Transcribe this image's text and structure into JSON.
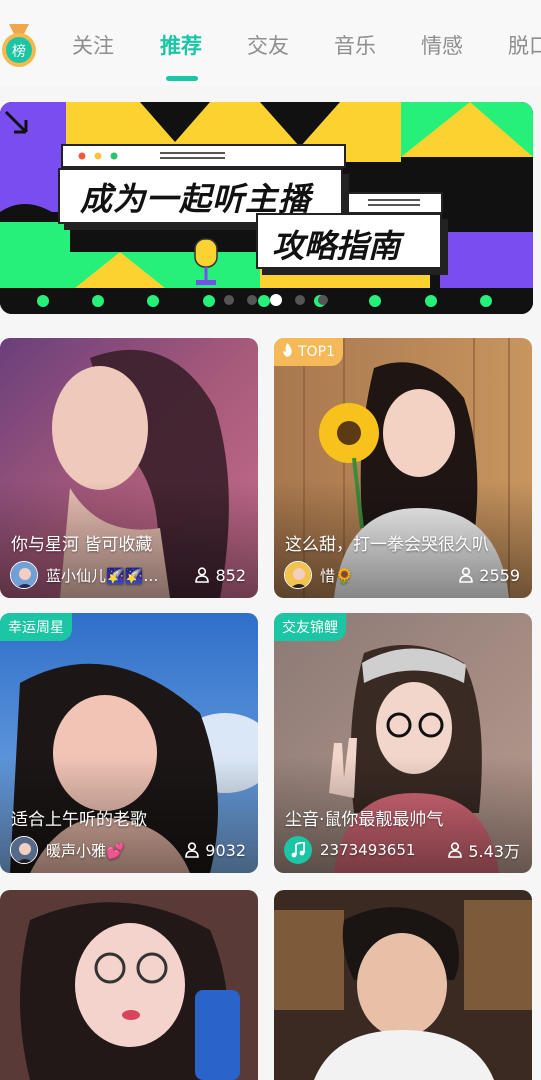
{
  "header": {
    "rank_badge_label": "榜",
    "tabs": [
      {
        "label": "关注",
        "active": false
      },
      {
        "label": "推荐",
        "active": true
      },
      {
        "label": "交友",
        "active": false
      },
      {
        "label": "音乐",
        "active": false
      },
      {
        "label": "情感",
        "active": false
      },
      {
        "label": "脱口",
        "active": false
      }
    ]
  },
  "banner": {
    "line1": "成为一起听主播",
    "line2": "攻略指南",
    "slide_count": 5,
    "active_slide": 3
  },
  "cards": [
    {
      "title": "你与星河 皆可收藏",
      "user": "蓝小仙儿🌠🌠…",
      "listeners": "852",
      "tag": "",
      "avatar_type": "photo"
    },
    {
      "title": "这么甜，打一拳会哭很久叭",
      "user": "惜🌻",
      "listeners": "2559",
      "tag": "TOP1",
      "tag_icon": "fire-icon",
      "avatar_type": "photo"
    },
    {
      "title": "适合上午听的老歌",
      "user": "暖声小雅💕",
      "listeners": "9032",
      "tag": "幸运周星",
      "avatar_type": "photo"
    },
    {
      "title": "尘音·鼠你最靓最帅气",
      "user": "2373493651",
      "listeners": "5.43万",
      "tag": "交友锦鲤",
      "avatar_type": "music-icon"
    },
    {
      "title": "",
      "user": "",
      "listeners": "",
      "tag": ""
    },
    {
      "title": "",
      "user": "",
      "listeners": "",
      "tag": ""
    }
  ],
  "colors": {
    "accent": "#1ac6a6",
    "tab_inactive": "#8e8e8e",
    "tag_green": "#1cc6a4",
    "tag_orange": "#f6b95a"
  }
}
